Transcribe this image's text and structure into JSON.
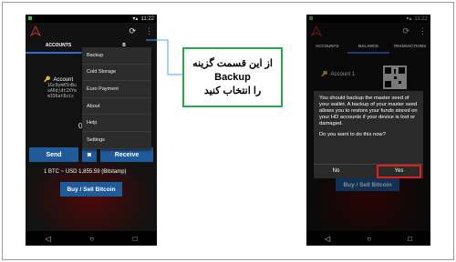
{
  "left": {
    "status_time": "11:22",
    "tabs": [
      "ACCOUNTS",
      "B"
    ],
    "account_label": "Account",
    "address_lines": [
      "1Gc9ymK5nBu",
      "xA6djdt2XYm",
      "m336at8zis"
    ],
    "balance_partial": "0.",
    "send_label": "Send",
    "receive_label": "Receive",
    "rate_text": "1 BTC ~ USD 1,855.59 (Bitstamp)",
    "buy_sell_label": "Buy / Sell Bitcoin",
    "menu": [
      "Backup",
      "Cold Storage",
      "Euro Payment",
      "About",
      "Help",
      "Settings"
    ]
  },
  "callout": {
    "line1": "از این قسمت گزینه",
    "line2": "Backup",
    "line3": "را انتخاب کنید"
  },
  "right": {
    "status_time": "11:22",
    "tabs": [
      "ACCOUNTS",
      "BALANCE",
      "TRANSACTIONS"
    ],
    "account_label": "Account 1",
    "dialog_message": "You should backup the master seed of your wallet. A backup of your master seed allows you to restore your funds stored on your HD accounts if your device is lost or damaged.",
    "dialog_question": "Do you want to do this now?",
    "no_label": "No",
    "yes_label": "Yes",
    "buy_sell_label": "Buy / Sell Bitcoin"
  },
  "colors": {
    "accent_blue": "#1f5a99",
    "callout_border": "#29a84a",
    "highlight_red": "#e0201c"
  }
}
